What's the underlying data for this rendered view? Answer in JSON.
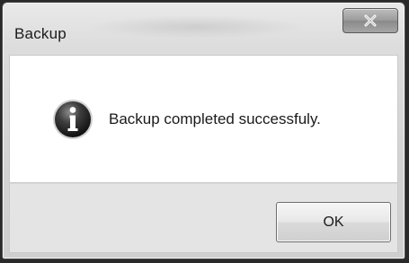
{
  "window": {
    "title": "Backup",
    "close_icon": "close-icon"
  },
  "dialog": {
    "icon": "info-icon",
    "message": "Backup completed successfuly."
  },
  "buttons": {
    "ok_label": "OK"
  }
}
